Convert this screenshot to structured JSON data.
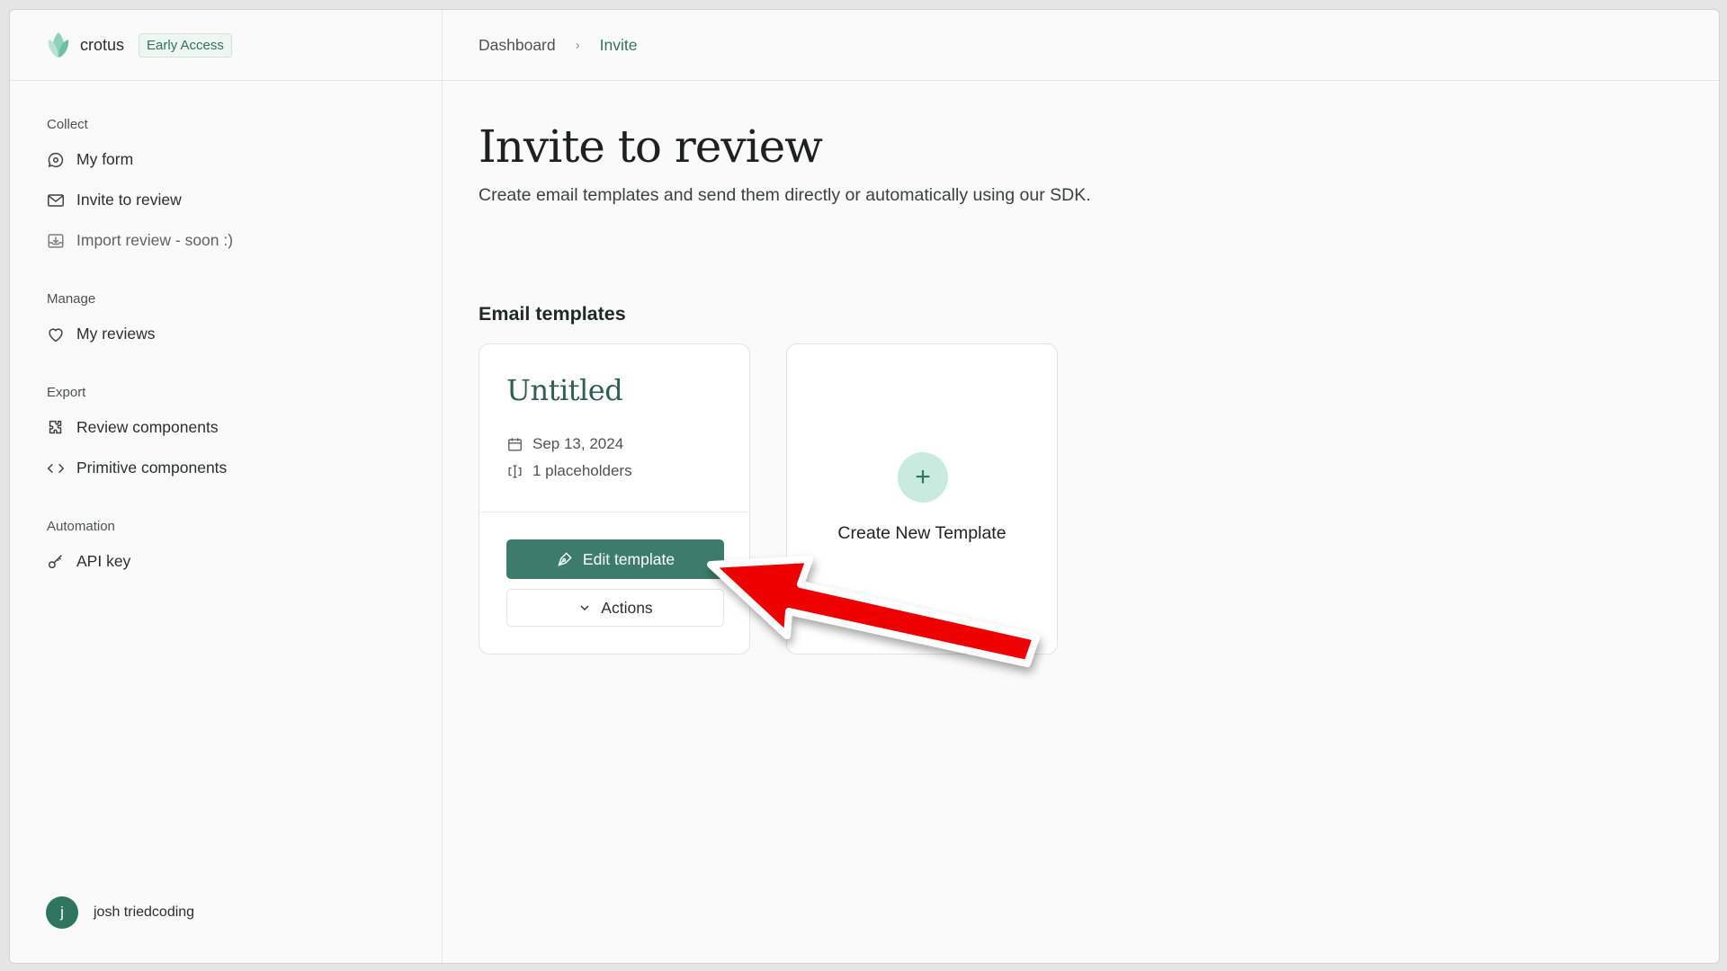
{
  "brand": {
    "name": "crotus",
    "badge": "Early Access"
  },
  "sidebar": {
    "sections": [
      {
        "title": "Collect",
        "items": [
          "My form",
          "Invite to review",
          "Import review - soon :)"
        ]
      },
      {
        "title": "Manage",
        "items": [
          "My reviews"
        ]
      },
      {
        "title": "Export",
        "items": [
          "Review components",
          "Primitive components"
        ]
      },
      {
        "title": "Automation",
        "items": [
          "API key"
        ]
      }
    ]
  },
  "user": {
    "initial": "j",
    "name": "josh triedcoding"
  },
  "breadcrumb": {
    "parent": "Dashboard",
    "current": "Invite"
  },
  "page": {
    "title": "Invite to review",
    "subtitle": "Create email templates and send them directly or automatically using our SDK."
  },
  "templates": {
    "heading": "Email templates",
    "card": {
      "name": "Untitled",
      "date": "Sep 13, 2024",
      "placeholders": "1 placeholders",
      "edit_label": "Edit template",
      "actions_label": "Actions"
    },
    "create_label": "Create New Template"
  },
  "colors": {
    "accent": "#3d7c6c",
    "badge_text": "#2f7560",
    "arrow": "#ee0000"
  }
}
